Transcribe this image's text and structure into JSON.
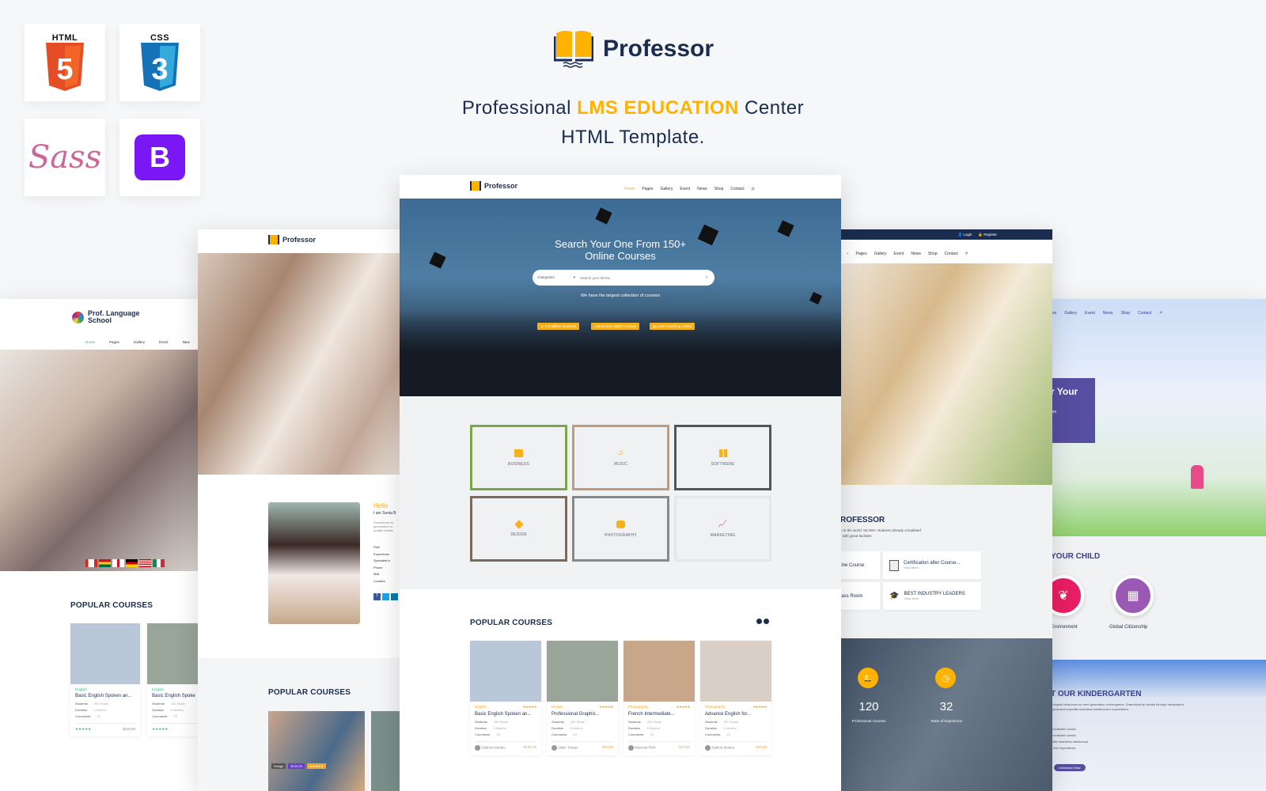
{
  "tech_badges": [
    {
      "name": "HTML",
      "label": "HTML",
      "glyph": "5",
      "color": "#e44d26"
    },
    {
      "name": "CSS",
      "label": "CSS",
      "glyph": "3",
      "color": "#1572b6"
    },
    {
      "name": "Sass",
      "label": "Sass",
      "color": "#cd6799"
    },
    {
      "name": "Bootstrap",
      "label": "B",
      "color": "#7a18f5"
    }
  ],
  "brand": {
    "name": "Professor"
  },
  "tagline": {
    "pre": "Professional ",
    "highlight": "LMS EDUCATION",
    "post": " Center",
    "line2": "HTML Template."
  },
  "center": {
    "brand": "Professor",
    "nav": [
      "Home",
      "Pages",
      "Gallery",
      "Event",
      "News",
      "Shop",
      "Contact"
    ],
    "hero_title_1": "Search Your One From 150+",
    "hero_title_2": "Online Courses",
    "search_category": "Categories",
    "search_placeholder": "Search your theme",
    "hero_sub": "We have the largest collection of courses",
    "pills": [
      "1.5 Million Students",
      "More then 2000 Courses",
      "Learn Anything Online"
    ],
    "categories": [
      {
        "label": "BUSINESS",
        "icon": "briefcase-icon"
      },
      {
        "label": "MUSIC",
        "icon": "music-note-icon"
      },
      {
        "label": "SOFTWERE",
        "icon": "windows-icon"
      },
      {
        "label": "DESIGN",
        "icon": "layers-icon"
      },
      {
        "label": "PHOTOGRAPHY",
        "icon": "camera-icon"
      },
      {
        "label": "MARKETING",
        "icon": "chart-icon"
      }
    ],
    "popular_title": "POPULAR COURSES",
    "courses": [
      {
        "cat": "English",
        "title": "Basic English Spoken an...",
        "students": "200 Seats",
        "duration": "3 Months",
        "comments": "23",
        "author": "Sabrina Modeo",
        "price": "$150.00",
        "img": "#b9c7d8"
      },
      {
        "cat": "Design",
        "title": "Professional Graphic...",
        "students": "200 Seats",
        "duration": "3 Months",
        "comments": "23",
        "author": "Jakie Tompo",
        "price": "$40.00",
        "img": "#9aa59a"
      },
      {
        "cat": "Photography",
        "title": "French Intermediate...",
        "students": "200 Seats",
        "duration": "3 Months",
        "comments": "23",
        "author": "Marcela Rich",
        "price": "$70.00",
        "img": "#c8a68a"
      },
      {
        "cat": "Photography",
        "title": "Advance English for...",
        "students": "200 Seats",
        "duration": "3 Months",
        "comments": "23",
        "author": "Sabine Modeo",
        "price": "$20.00",
        "img": "#d9cfc6"
      }
    ],
    "row_labels": {
      "students": "Students",
      "duration": "Duration",
      "comments": "Comments"
    }
  },
  "left2": {
    "brand": "Professor",
    "hello": "Hello",
    "name": "I am Sonia B",
    "bio": "Proactively en generation co quality vortals",
    "fields": [
      "Role",
      "Experience",
      "Specialist in",
      "Phone",
      "Mail",
      "Location"
    ],
    "popular_title": "POPULAR COURSES",
    "badges": [
      "Design",
      "$120.00",
      "★★★★★"
    ]
  },
  "left1": {
    "brand_line1": "Prof. Language",
    "brand_line2": "School",
    "nav": [
      "Home",
      "Pages",
      "Gallery",
      "Event",
      "New"
    ],
    "popular_title": "POPULAR COURSES",
    "courses": [
      {
        "cat": "English",
        "title": "Basic English Spoken an...",
        "students": "200 Seats",
        "duration": "3 Months",
        "comments": "23",
        "price": "$110.00"
      },
      {
        "cat": "English",
        "title": "Basic English Spoke",
        "students": "200 Seats",
        "duration": "3 Months",
        "comments": "23"
      }
    ]
  },
  "right1": {
    "login": "Login",
    "register": "Register",
    "nav": [
      "Home",
      "Pages",
      "Gallery",
      "Event",
      "News",
      "Shop",
      "Contact"
    ],
    "about_title": "ROFESSOR",
    "about_text_1": "n in the world. 50,000+ students already completed",
    "about_text_2": "r with great facilities",
    "features": [
      {
        "label": "line Course"
      },
      {
        "label": "Certification after Course...",
        "sub": "View More"
      },
      {
        "label": "lass Room"
      },
      {
        "label": "BEST INDUSTRY LEADERS",
        "sub": "View More"
      }
    ],
    "stats": [
      {
        "value": "120",
        "label": "Professional Courses"
      },
      {
        "value": "32",
        "label": "Years of Experience"
      }
    ]
  },
  "right2": {
    "nav": [
      "es",
      "Gallery",
      "Event",
      "News",
      "Shop",
      "Contact"
    ],
    "hero_title": "r Your",
    "hero_sub": "ure",
    "child_title": "YOUR CHILD",
    "circles": [
      {
        "label": "Environment",
        "color": "#e91e63"
      },
      {
        "label": "Global Citizenship",
        "color": "#9b59b6"
      }
    ],
    "kinder_title": "T OUR KINDERGARTEN",
    "kinder_text": "prospect resources for next generation convergence. Dramatical ity vortals through transparent. Dynamical expedite seamless intellectual e imperatives.",
    "bullets": [
      "ocordinate vortals",
      "ocordinate vortals",
      "edite seamless intellectual",
      "g-line imperatives."
    ],
    "button": "Admission Now"
  }
}
